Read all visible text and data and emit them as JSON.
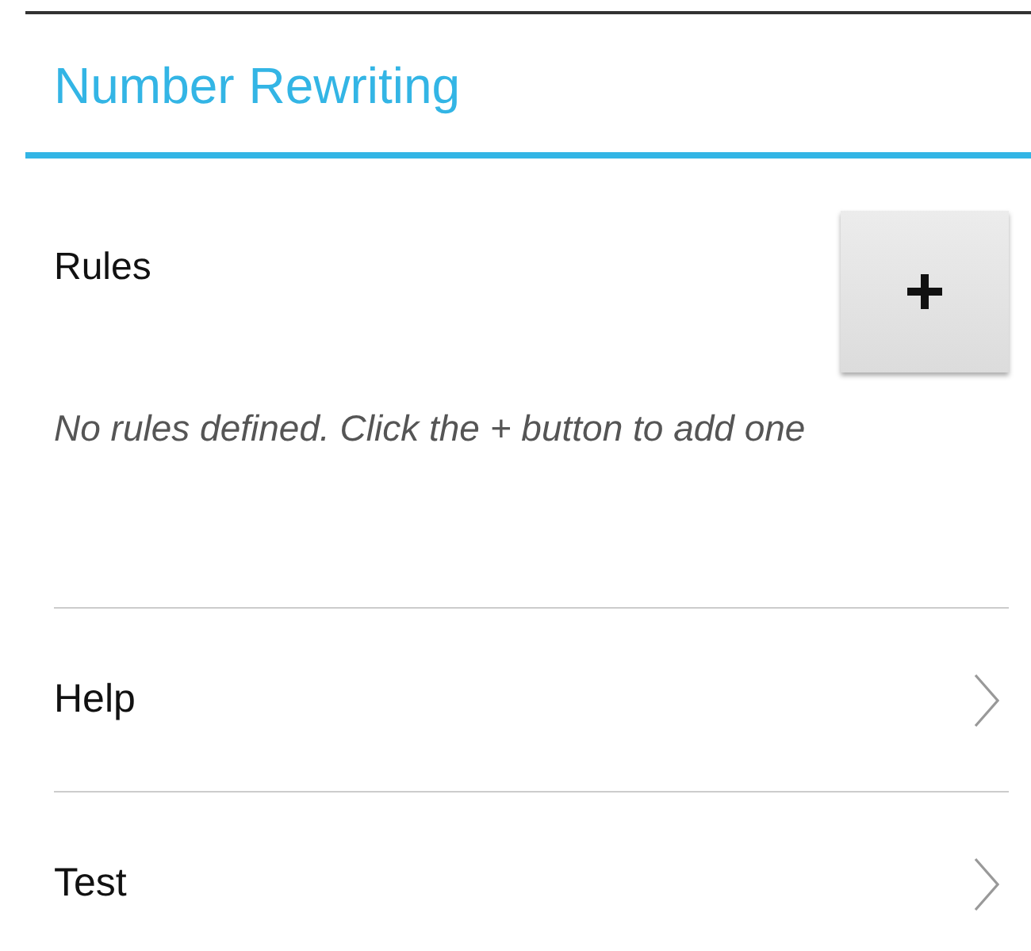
{
  "title": "Number Rewriting",
  "rules": {
    "label": "Rules",
    "empty_message": "No rules defined. Click the + button to add one"
  },
  "items": [
    {
      "label": "Help"
    },
    {
      "label": "Test"
    }
  ]
}
